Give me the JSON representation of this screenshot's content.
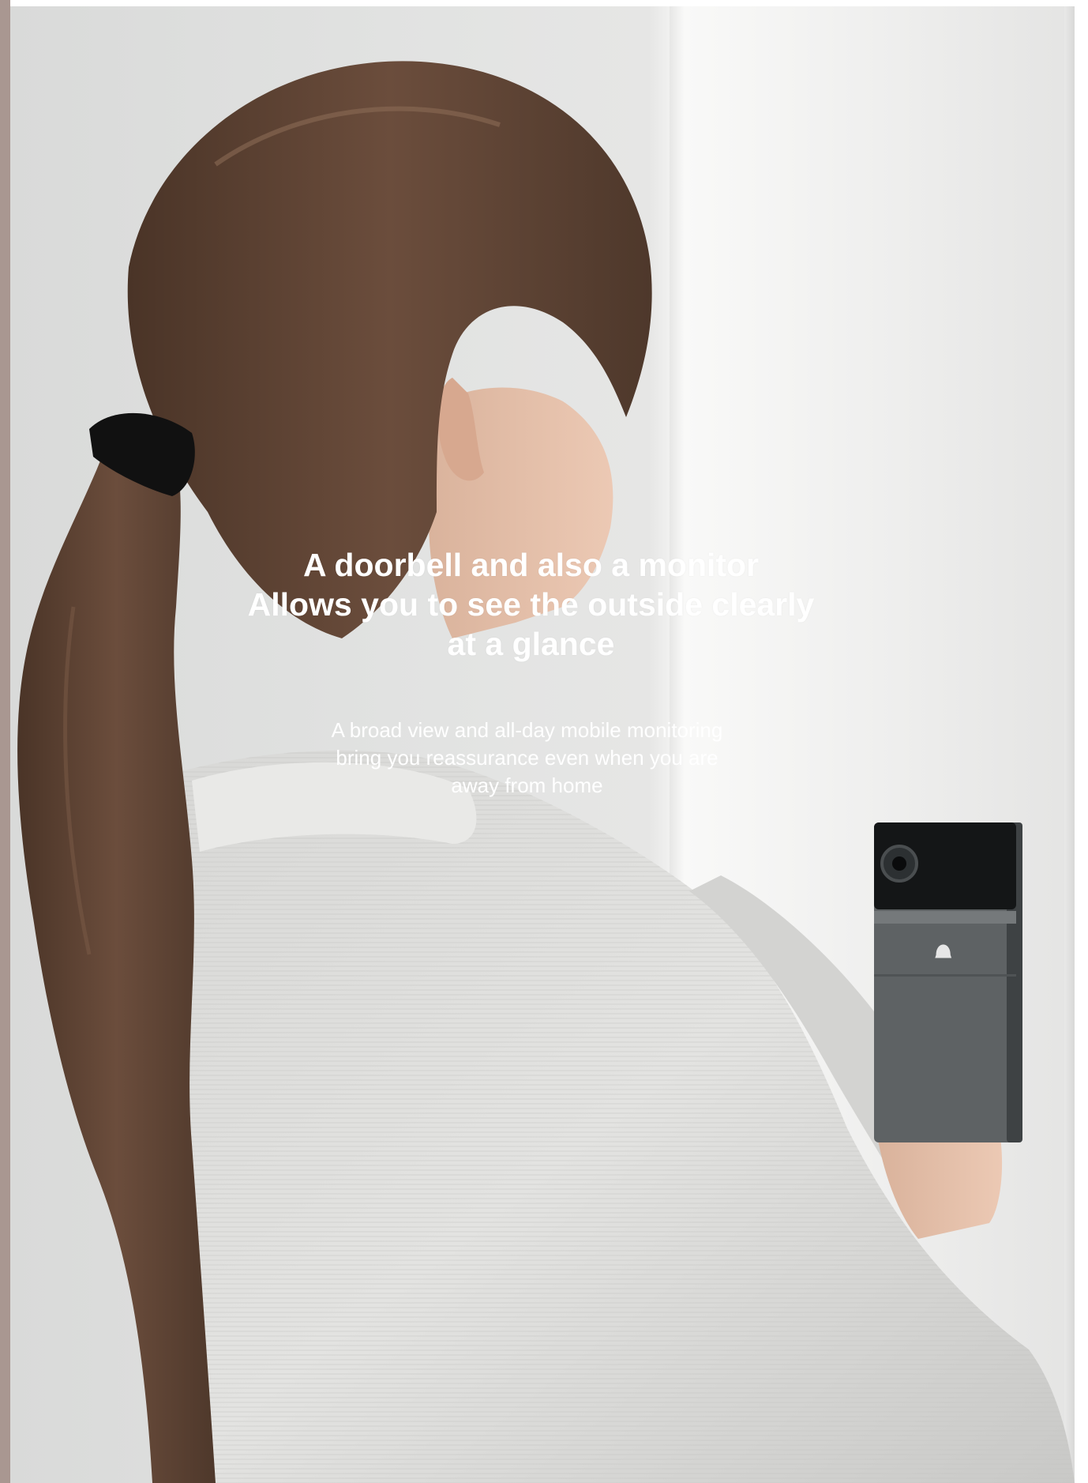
{
  "headline": {
    "line1": "A doorbell and also a monitor",
    "line2": "Allows you to see the outside clearly",
    "line3": "at a glance"
  },
  "subtext": {
    "line1": "A broad view and all-day mobile monitoring",
    "line2": "bring you reassurance even when you are",
    "line3": "away from home"
  },
  "colors": {
    "text": "#ffffff",
    "left_strip": "#a99791",
    "doorbell_body": "#5e6264",
    "doorbell_camera_panel": "#141617"
  },
  "icons": {
    "doorbell_button": "bell-icon"
  }
}
